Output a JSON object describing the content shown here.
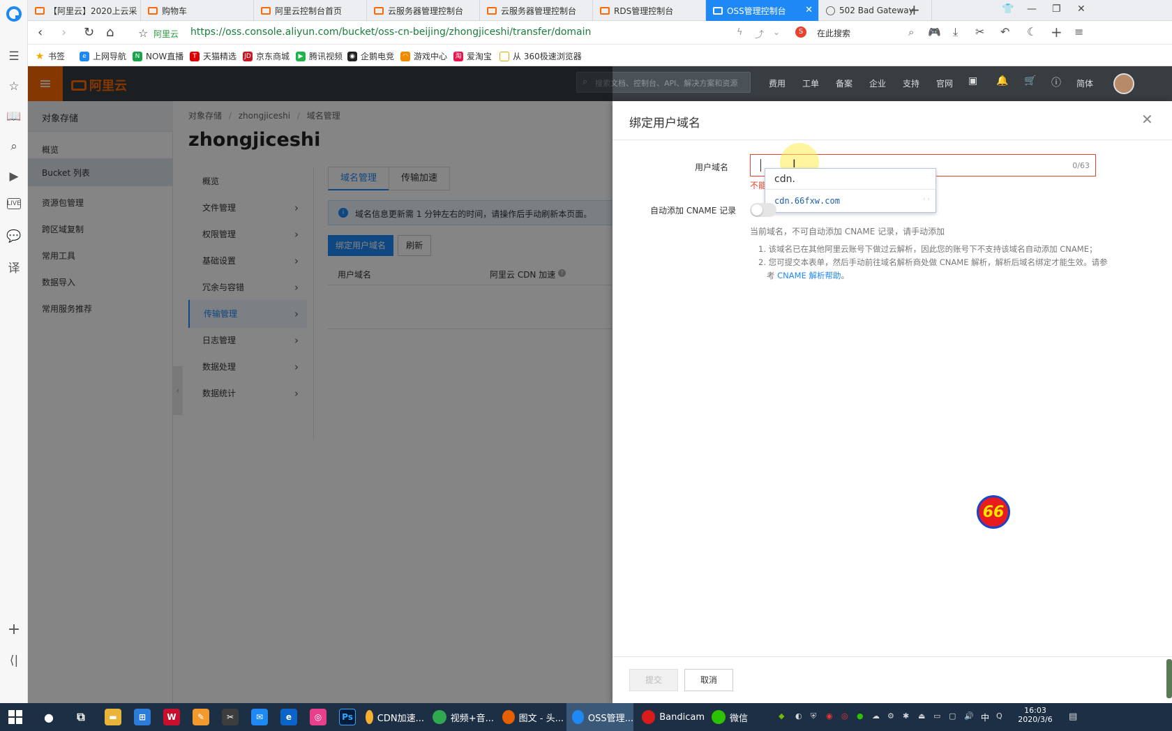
{
  "tabs": [
    {
      "label": "【阿里云】2020上云采",
      "active": false
    },
    {
      "label": "购物车",
      "active": false
    },
    {
      "label": "阿里云控制台首页",
      "active": false
    },
    {
      "label": "云服务器管理控制台",
      "active": false
    },
    {
      "label": "云服务器管理控制台",
      "active": false
    },
    {
      "label": "RDS管理控制台",
      "active": false
    },
    {
      "label": "OSS管理控制台",
      "active": true
    },
    {
      "label": "502 Bad Gateway",
      "active": false
    }
  ],
  "address": {
    "site_label": "阿里云",
    "url": "https://oss.console.aliyun.com/bucket/oss-cn-beijing/zhongjiceshi/transfer/domain",
    "search_label": "在此搜索"
  },
  "bookmarks": [
    "书签",
    "上网导航",
    "NOW直播",
    "天猫精选",
    "京东商城",
    "腾讯视频",
    "企鹅电竞",
    "游戏中心",
    "爱淘宝",
    "从 360极速浏览器"
  ],
  "console": {
    "logo_text": "阿里云",
    "search_placeholder": "搜索文档、控制台、API、解决方案和资源",
    "nav": [
      "费用",
      "工单",
      "备案",
      "企业",
      "支持",
      "官网",
      "简体"
    ]
  },
  "left_menu": {
    "title": "对象存储",
    "items": [
      "概览",
      "Bucket 列表",
      "资源包管理",
      "跨区域复制",
      "常用工具",
      "数据导入",
      "常用服务推荐"
    ]
  },
  "content": {
    "breadcrumb": [
      "对象存储",
      "zhongjiceshi",
      "域名管理"
    ],
    "bucket_name": "zhongjiceshi",
    "sub_menu": [
      "概览",
      "文件管理",
      "权限管理",
      "基础设置",
      "冗余与容错",
      "传输管理",
      "日志管理",
      "数据处理",
      "数据统计"
    ],
    "tabs": [
      "域名管理",
      "传输加速"
    ],
    "info": "域名信息更新需 1 分钟左右的时间，请操作后手动刷新本页面。",
    "bind_button": "绑定用户域名",
    "refresh_button": "刷新",
    "col_domain": "用户域名",
    "col_cdn": "阿里云 CDN 加速"
  },
  "drawer": {
    "title": "绑定用户域名",
    "domain_label": "用户域名",
    "domain_value": "",
    "char_count": "0/63",
    "error_text": "不能",
    "autocomplete_typed": "cdn.",
    "autocomplete_option": "cdn.66fxw.com",
    "cname_label": "自动添加 CNAME 记录",
    "cname_note": "当前域名，不可自动添加 CNAME 记录，请手动添加",
    "notes": [
      "1. 该域名已在其他阿里云账号下做过云解析，因此您的账号下不支持该域名自动添加 CNAME；",
      "2. 您可提交本表单，然后手动前往域名解析商处做 CNAME 解析，解析后域名绑定才能生效。请参"
    ],
    "note_cont": "考 ",
    "cname_help_link": "CNAME 解析帮助",
    "note_end": "。",
    "submit": "提交",
    "cancel": "取消"
  },
  "badge": "66",
  "taskbar": {
    "apps": [
      "CDN加速...",
      "视频+音...",
      "图文 - 头...",
      "OSS管理...",
      "Bandicam",
      "微信"
    ],
    "tray_lang": "中",
    "time": "16:03",
    "date": "2020/3/6"
  }
}
